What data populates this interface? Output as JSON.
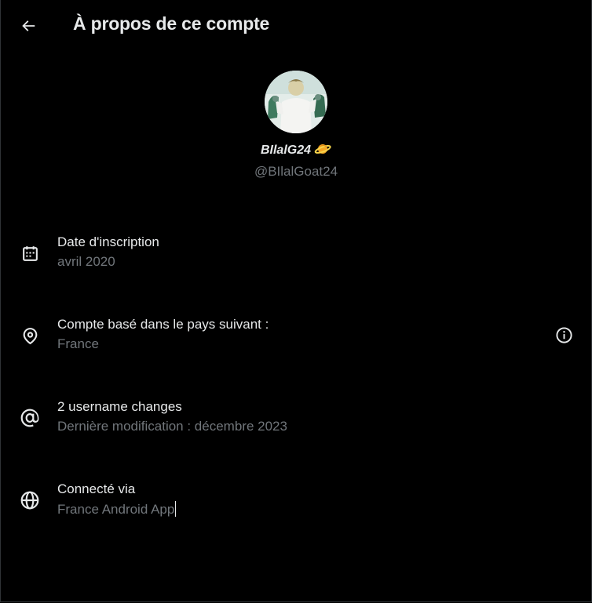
{
  "header": {
    "back_icon": "arrow-left-icon",
    "title": "À propos de ce compte"
  },
  "profile": {
    "avatar_icon": "avatar",
    "display_name": "BIlalG24",
    "display_name_emoji": "planet-emoji",
    "handle": "@BIlalGoat24"
  },
  "rows": [
    {
      "icon": "calendar-icon",
      "label": "Date d'inscription",
      "value": "avril 2020"
    },
    {
      "icon": "location-pin-icon",
      "label": "Compte basé dans le pays suivant :",
      "value": "France",
      "trailing_icon": "info-icon"
    },
    {
      "icon": "at-sign-icon",
      "label": "2 username changes",
      "value": "Dernière modification : décembre 2023"
    },
    {
      "icon": "globe-icon",
      "label": "Connecté via",
      "value": "France Android App"
    }
  ],
  "colors": {
    "background": "#000000",
    "primary_text": "#e7e9ea",
    "secondary_text": "#71767b",
    "border": "#2f3336"
  }
}
